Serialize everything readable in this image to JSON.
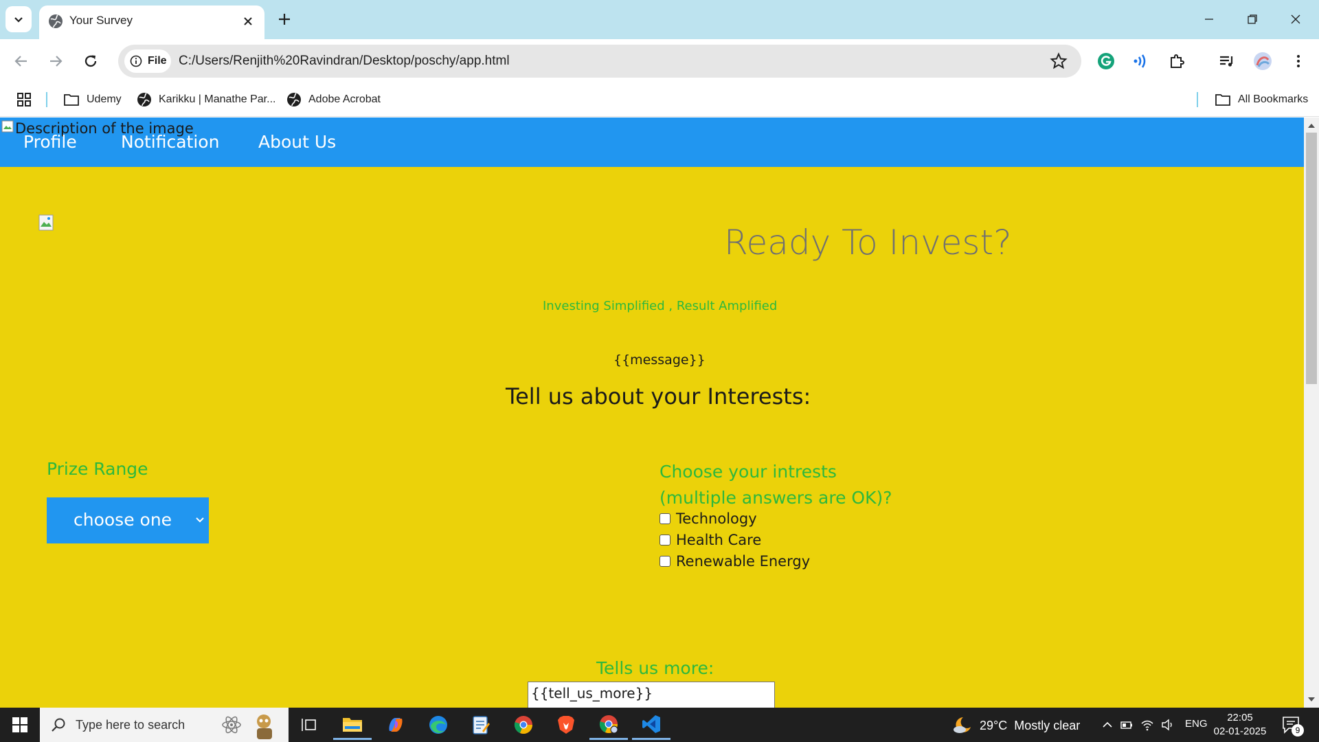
{
  "browser": {
    "tab_title": "Your Survey",
    "site_chip_label": "File",
    "url": "C:/Users/Renjith%20Ravindran/Desktop/poschy/app.html",
    "bookmarks": [
      {
        "label": "Udemy",
        "icon": "folder-icon"
      },
      {
        "label": "Karikku | Manathe Par...",
        "icon": "globe-icon"
      },
      {
        "label": "Adobe Acrobat",
        "icon": "globe-icon"
      }
    ],
    "all_bookmarks": "All Bookmarks"
  },
  "page": {
    "broken_image_alt": "Description of the image",
    "nav": [
      "Profile",
      "Notification",
      "About Us"
    ],
    "hero_title": "Ready To Invest?",
    "hero_subtitle": "Investing Simplified , Result Amplified",
    "message": "{{message}}",
    "section_title": "Tell us about your Interests:",
    "prize_label": "Prize Range",
    "prize_select_value": "choose one",
    "interests_label_line1": "Choose your intrests",
    "interests_label_line2": "(multiple answers are OK)?",
    "interests": [
      "Technology",
      "Health Care",
      "Renewable Energy"
    ],
    "tell_more_label": "Tells us more:",
    "tell_more_value": "{{tell_us_more}}"
  },
  "taskbar": {
    "search_placeholder": "Type here to search",
    "weather_temp": "29°C",
    "weather_desc": "Mostly clear",
    "language": "ENG",
    "time": "22:05",
    "date": "02-01-2025",
    "notification_count": "9"
  },
  "colors": {
    "page_background": "#ebd20a",
    "nav_blue": "#2196f0",
    "accent_green": "#2db83d",
    "tabstrip": "#bde3ef"
  }
}
